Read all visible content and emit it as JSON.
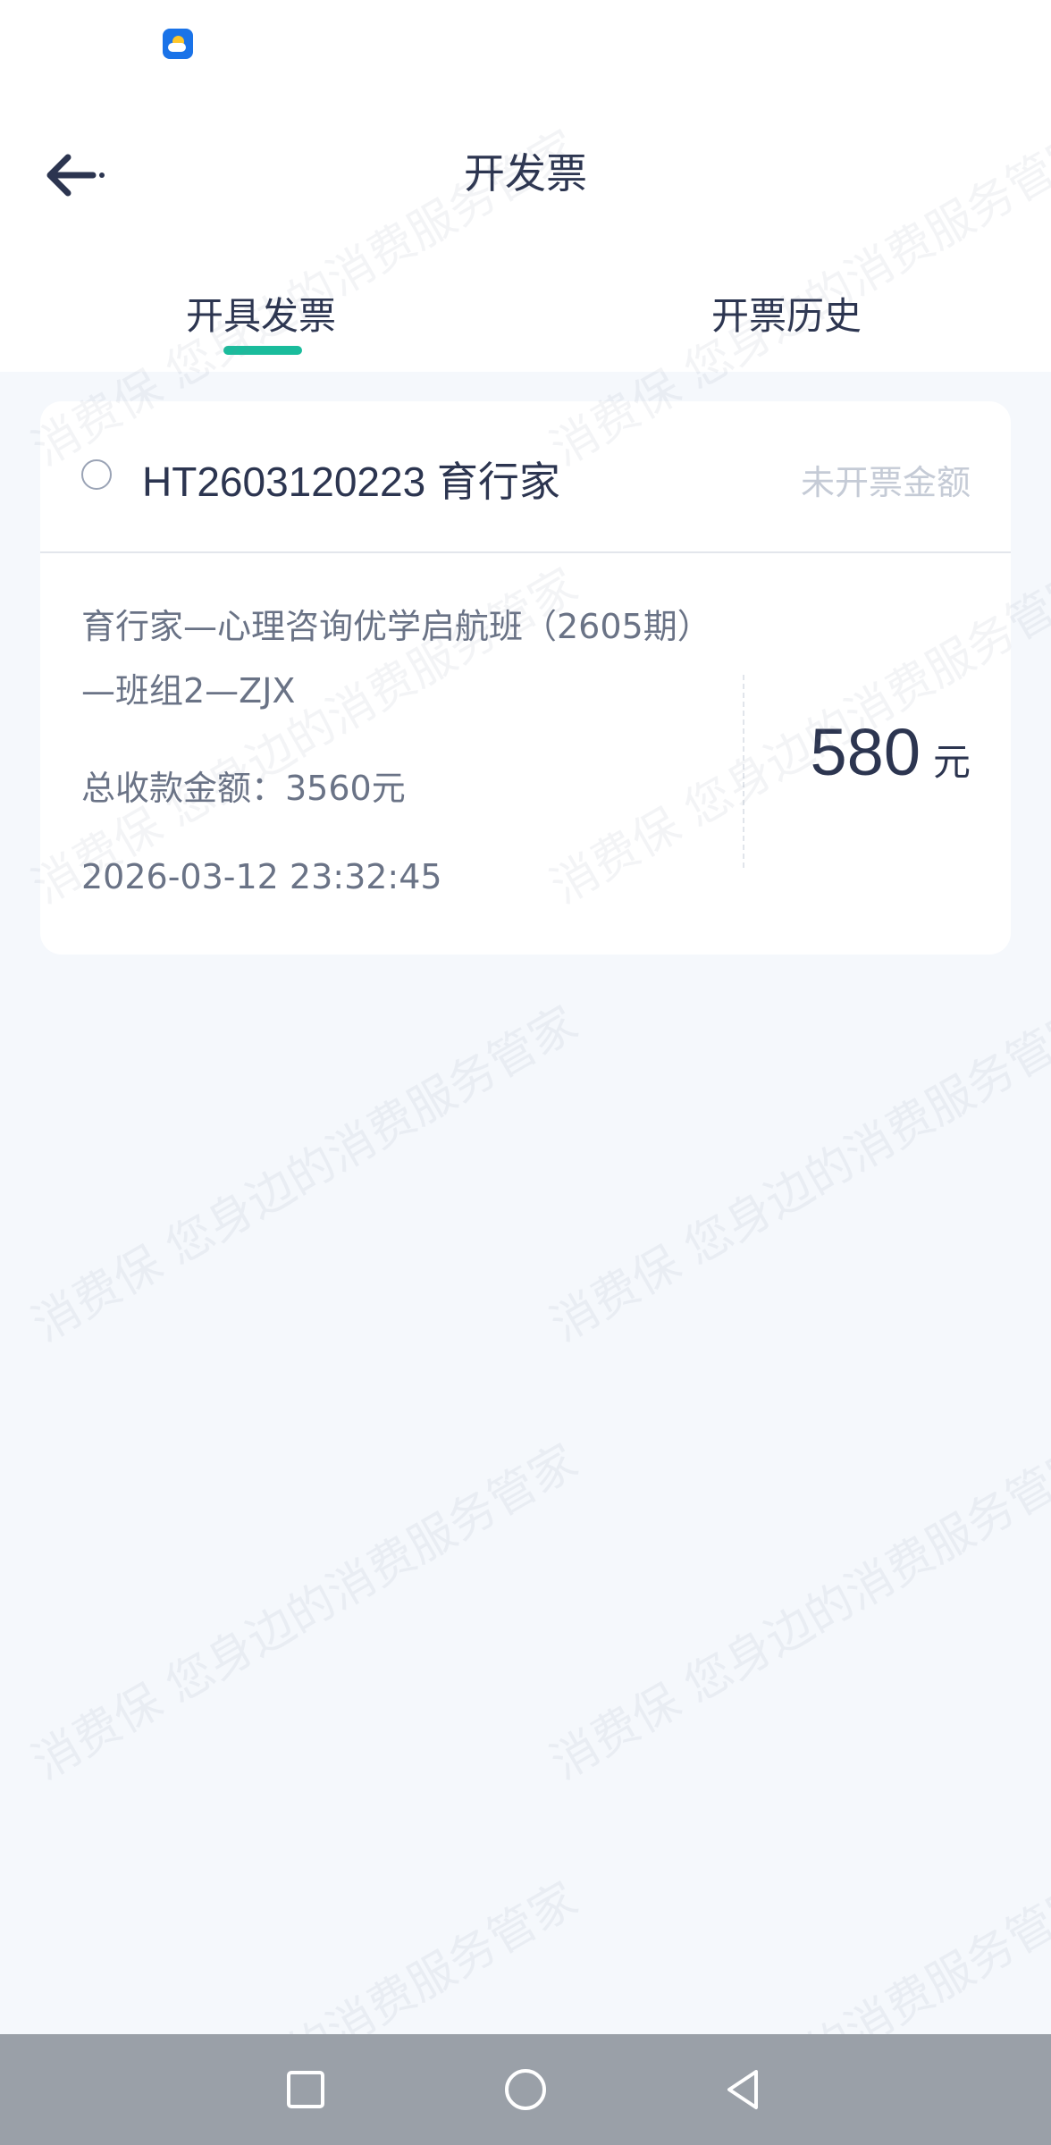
{
  "status_bar": {
    "app_icon": "weather-icon"
  },
  "header": {
    "title": "开发票",
    "back_icon": "arrow-left-icon"
  },
  "tabs": [
    {
      "label": "开具发票",
      "active": true
    },
    {
      "label": "开票历史",
      "active": false
    }
  ],
  "colors": {
    "accent": "#1ABC9C",
    "text_primary": "#2C3550",
    "text_secondary": "#6A7386",
    "text_muted": "#C5CBD6",
    "background": "#F5F8FC",
    "nav_bar": "#9AA0A8"
  },
  "invoice_card": {
    "order_title": "HT2603120223 育行家",
    "uninvoiced_label": "未开票金额",
    "product_desc": "育行家—心理咨询优学启航班（2605期）—班组2—ZJX",
    "total_amount": "总收款金额：3560元",
    "datetime": "2026-03-12 23:32:45",
    "amount": "580",
    "amount_unit": "元",
    "selected": false
  },
  "watermark": {
    "text": "消费保 您身边的消费服务管家"
  },
  "nav_bar": {
    "recent_icon": "square-icon",
    "home_icon": "circle-icon",
    "back_icon": "triangle-back-icon"
  }
}
